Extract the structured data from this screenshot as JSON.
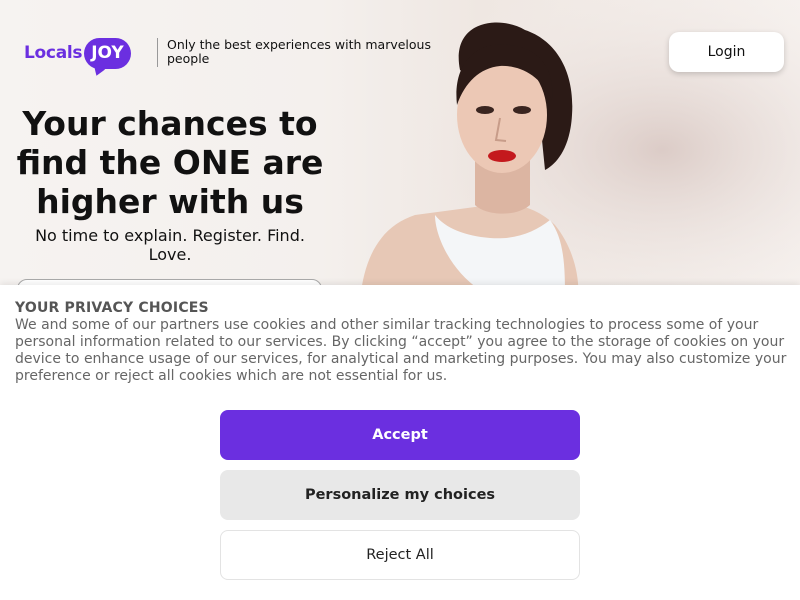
{
  "brand": {
    "logo_part1": "Locals",
    "logo_part2": "JOY",
    "tagline": "Only the best experiences with marvelous people",
    "accent_color": "#6b2fe0"
  },
  "header": {
    "login_label": "Login"
  },
  "hero": {
    "headline": "Your chances to find the ONE are higher with us",
    "subline": "No time to explain. Register. Find. Love."
  },
  "privacy": {
    "title": "YOUR PRIVACY CHOICES",
    "text": "We and some of our partners use cookies and other similar tracking technologies to process some of your personal information related to our services. By clicking “accept” you agree to the storage of cookies on your device to enhance usage of our services, for analytical and marketing purposes. You may also customize your preference or reject all cookies which are not essential for us.",
    "accept_label": "Accept",
    "personalize_label": "Personalize my choices",
    "reject_label": "Reject All"
  }
}
